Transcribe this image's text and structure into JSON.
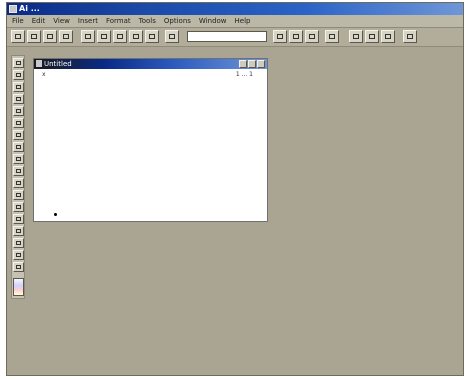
{
  "app": {
    "title": "Ai ..."
  },
  "menu": [
    "File",
    "Edit",
    "View",
    "Insert",
    "Format",
    "Tools",
    "Options",
    "Window",
    "Help"
  ],
  "toolbar": {
    "input_value": ""
  },
  "document": {
    "title": "Untitled",
    "ruler_left": "x",
    "ruler_right": "1 ... 1"
  },
  "icons": {
    "app_icon": "app-icon",
    "doc_icon": "doc-icon",
    "minimize": "minimize-icon",
    "maximize": "maximize-icon",
    "close": "close-icon"
  }
}
